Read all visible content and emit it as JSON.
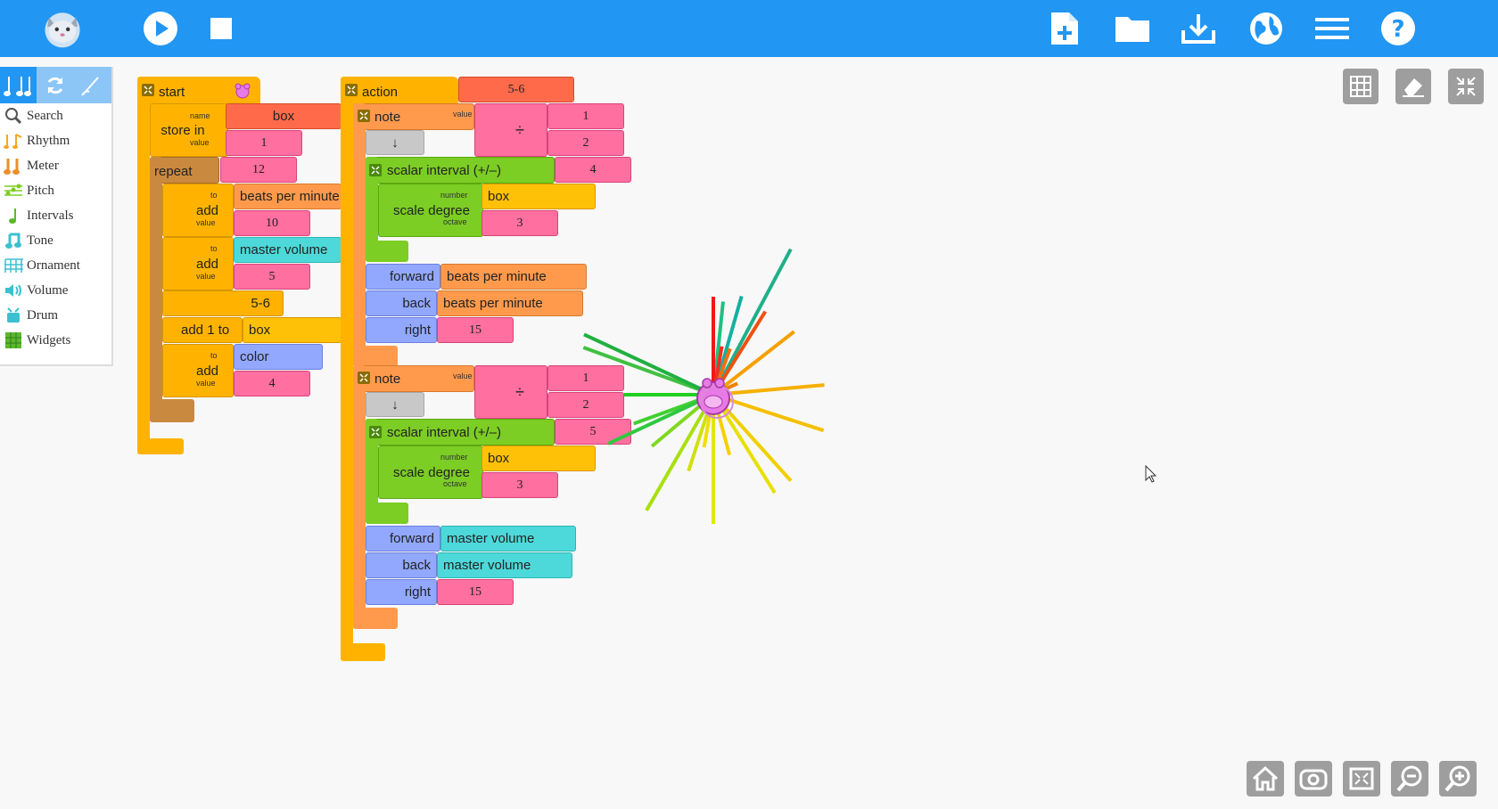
{
  "toolbar": {
    "buttons": [
      {
        "name": "logo",
        "icon": "mouse-logo-icon"
      },
      {
        "name": "play",
        "icon": "play-icon"
      },
      {
        "name": "stop",
        "icon": "stop-icon"
      },
      {
        "name": "new",
        "icon": "new-file-icon"
      },
      {
        "name": "load",
        "icon": "folder-icon"
      },
      {
        "name": "save",
        "icon": "download-icon"
      },
      {
        "name": "language",
        "icon": "globe-icon"
      },
      {
        "name": "menu",
        "icon": "hamburger-icon"
      },
      {
        "name": "help",
        "icon": "help-icon"
      }
    ]
  },
  "palette": {
    "items": [
      "Search",
      "Rhythm",
      "Meter",
      "Pitch",
      "Intervals",
      "Tone",
      "Ornament",
      "Volume",
      "Drum",
      "Widgets"
    ]
  },
  "start_stack": {
    "start_label": "start",
    "store_in_label": "store in",
    "name_label": "name",
    "value_label": "value",
    "box_name": "box",
    "store_value": "1",
    "repeat_label": "repeat",
    "repeat_count": "12",
    "add_label": "add",
    "to_label": "to",
    "add1_target": "beats per minute",
    "add1_value": "10",
    "add2_target": "master volume",
    "add2_value": "5",
    "action_call": "5-6",
    "add1to_label": "add 1 to",
    "add1to_target": "box",
    "add3_target": "color",
    "add3_value": "4"
  },
  "action_stack": {
    "action_label": "action",
    "action_name": "5-6",
    "notes": [
      {
        "note_label": "note",
        "value_label": "value",
        "numerator": "1",
        "denominator": "2",
        "divide_symbol": "÷",
        "arrow": "↓",
        "scalar_label": "scalar interval (+/–)",
        "scalar_value": "4",
        "scale_degree_label": "scale degree",
        "number_label": "number",
        "octave_label": "octave",
        "number_value": "box",
        "octave_value": "3",
        "forward_label": "forward",
        "forward_value": "beats per minute",
        "back_label": "back",
        "back_value": "beats per minute",
        "right_label": "right",
        "right_value": "15"
      },
      {
        "note_label": "note",
        "value_label": "value",
        "numerator": "1",
        "denominator": "2",
        "divide_symbol": "÷",
        "arrow": "↓",
        "scalar_label": "scalar interval (+/–)",
        "scalar_value": "5",
        "scale_degree_label": "scale degree",
        "number_label": "number",
        "octave_label": "octave",
        "number_value": "box",
        "octave_value": "3",
        "forward_label": "forward",
        "forward_value": "master volume",
        "back_label": "back",
        "back_value": "master volume",
        "right_label": "right",
        "right_value": "15"
      }
    ]
  },
  "canvas_tools": [
    "grid-icon",
    "eraser-icon",
    "collapse-icon"
  ],
  "bottom_tools": [
    "home-icon",
    "show-hide-icon",
    "expand-icon",
    "zoom-out-icon",
    "zoom-in-icon"
  ],
  "colors": {
    "toolbar": "#2196f3",
    "flow": "#ffb300",
    "repeat": "#c98a40",
    "number": "#ff6fa0",
    "box": "#ff7043",
    "boxes_yellow": "#ffc107",
    "orange_block": "#ff9a4d",
    "cyan_block": "#4dd9d9",
    "blue_block": "#92a8ff",
    "pitch": "#7ccd24",
    "turtle": "#8ea0ff"
  }
}
